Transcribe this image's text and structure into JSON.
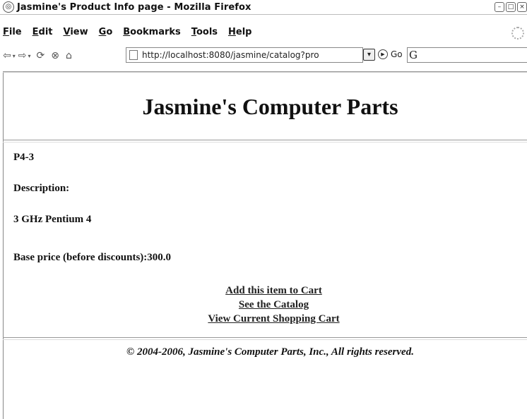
{
  "window": {
    "title": "Jasmine's Product Info page - Mozilla Firefox"
  },
  "menu": {
    "items": [
      {
        "u": "F",
        "rest": "ile"
      },
      {
        "u": "E",
        "rest": "dit"
      },
      {
        "u": "V",
        "rest": "iew"
      },
      {
        "u": "G",
        "rest": "o"
      },
      {
        "u": "B",
        "rest": "ookmarks"
      },
      {
        "u": "T",
        "rest": "ools"
      },
      {
        "u": "H",
        "rest": "elp"
      }
    ]
  },
  "navbar": {
    "url": "http://localhost:8080/jasmine/catalog?pro",
    "go_label": "Go",
    "search_glyph": "G"
  },
  "page": {
    "heading": "Jasmine's Computer Parts",
    "product_id": "P4-3",
    "description_label": "Description:",
    "description": "3 GHz Pentium 4",
    "price": "Base price (before discounts):300.0",
    "links": {
      "add_to_cart": "Add this item to Cart",
      "see_catalog": "See the Catalog",
      "view_cart": "View Current Shopping Cart"
    },
    "copyright": "© 2004-2006, Jasmine's Computer Parts, Inc., All rights reserved."
  }
}
